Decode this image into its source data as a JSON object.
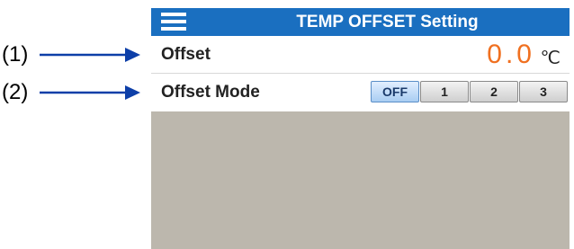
{
  "callouts": [
    {
      "label": "(1)"
    },
    {
      "label": "(2)"
    }
  ],
  "header": {
    "title": "TEMP OFFSET Setting",
    "menu_icon": "hamburger-menu-icon"
  },
  "offset": {
    "label": "Offset",
    "value": "0.0",
    "unit": "℃"
  },
  "offset_mode": {
    "label": "Offset Mode",
    "options": [
      "OFF",
      "1",
      "2",
      "3"
    ],
    "selected": "OFF"
  },
  "colors": {
    "titlebar": "#1a6fc0",
    "value": "#f07020",
    "background": "#bcb7ad"
  }
}
